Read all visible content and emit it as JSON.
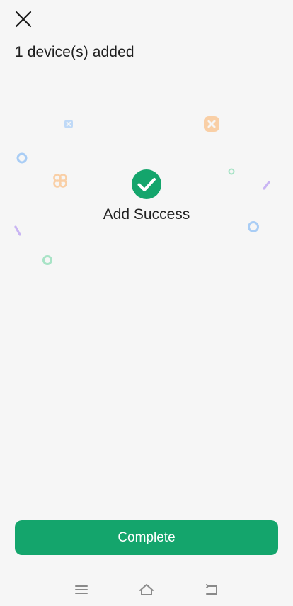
{
  "header": {
    "close_icon": "close-icon",
    "title": "1 device(s) added"
  },
  "result": {
    "icon": "check-circle-icon",
    "status_text": "Add Success",
    "accent_color": "#14a56c"
  },
  "actions": {
    "complete_label": "Complete"
  },
  "system_nav": {
    "menu_icon": "menu-icon",
    "home_icon": "home-icon",
    "back_icon": "back-icon"
  },
  "decorations": {
    "confetti_colors": [
      "#a9cdf5",
      "#f9cfa6",
      "#a8e3c6",
      "#c9b5f3"
    ]
  }
}
